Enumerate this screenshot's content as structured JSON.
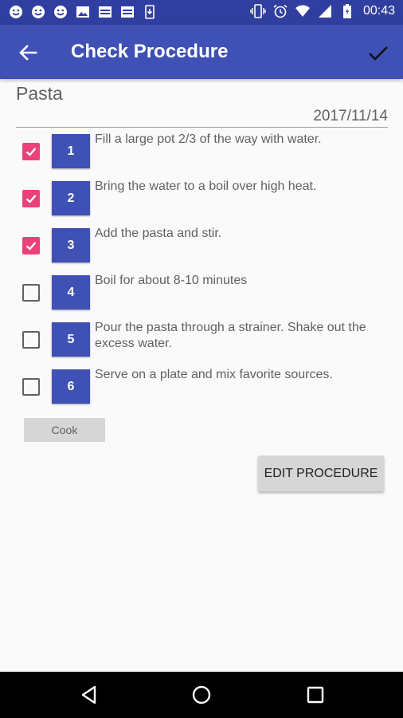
{
  "status_bar": {
    "time": "00:43",
    "left_icons": [
      "smiley-icon",
      "smiley-icon",
      "smiley-icon",
      "image-icon",
      "calendar-icon",
      "calendar-icon",
      "download-icon"
    ],
    "right_icons": [
      "vibrate-icon",
      "alarm-icon",
      "wifi-icon",
      "signal-icon",
      "battery-icon"
    ]
  },
  "app_bar": {
    "title": "Check Procedure",
    "color": "#3f51b5",
    "status_color": "#303f9f"
  },
  "recipe": {
    "name": "Pasta",
    "date": "2017/11/14"
  },
  "steps": [
    {
      "number": "1",
      "text": "Fill a large pot 2/3 of the way with water.",
      "checked": true
    },
    {
      "number": "2",
      "text": "Bring the water to a boil over high heat.",
      "checked": true
    },
    {
      "number": "3",
      "text": "Add the pasta and stir.",
      "checked": true
    },
    {
      "number": "4",
      "text": "Boil for about 8-10 minutes",
      "checked": false
    },
    {
      "number": "5",
      "text": "Pour the pasta through a strainer. Shake out the excess water.",
      "checked": false
    },
    {
      "number": "6",
      "text": "Serve on a plate and mix favorite sources.",
      "checked": false
    }
  ],
  "buttons": {
    "cook": "Cook",
    "edit_procedure": "EDIT PROCEDURE"
  },
  "colors": {
    "accent": "#ec407a",
    "primary": "#3f51b5"
  }
}
